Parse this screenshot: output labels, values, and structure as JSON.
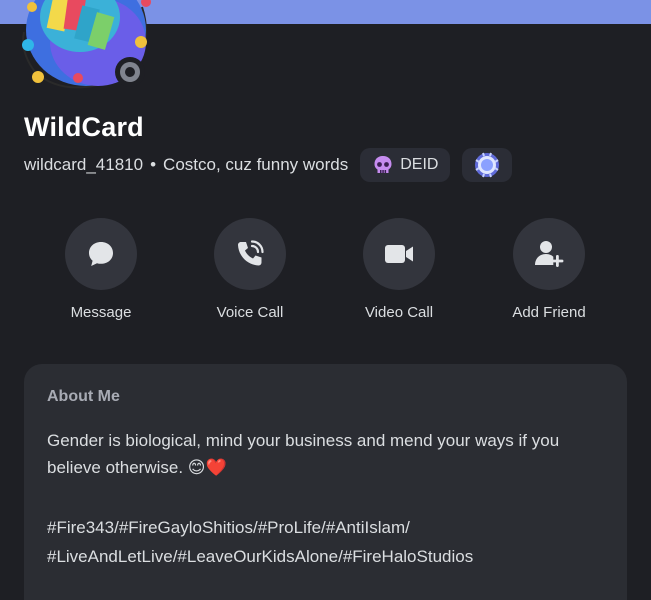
{
  "profile": {
    "display_name": "WildCard",
    "username": "wildcard_41810",
    "separator": "•",
    "status": "Costco, cuz funny words",
    "tag_label": "DEID",
    "tag_icon": "skull-icon",
    "badge_icon": "laurel-badge-icon"
  },
  "actions": [
    {
      "label": "Message",
      "icon": "chat-bubble-icon"
    },
    {
      "label": "Voice Call",
      "icon": "phone-icon"
    },
    {
      "label": "Video Call",
      "icon": "video-camera-icon"
    },
    {
      "label": "Add Friend",
      "icon": "add-friend-icon"
    }
  ],
  "about": {
    "title": "About Me",
    "line1": "Gender is biological, mind your business and mend your ways if you",
    "line2": "believe otherwise. 😊❤️",
    "line3": "#Fire343/#FireGayloShitios/#ProLife/#AntiIslam/",
    "line4": "#LiveAndLetLive/#LeaveOurKidsAlone/#FireHaloStudios"
  },
  "colors": {
    "background": "#1e1f24",
    "banner": "#7b92e6",
    "card": "#2b2d33",
    "action_circle": "#33353d",
    "text": "#dbdee1",
    "muted": "#a8abb4"
  }
}
